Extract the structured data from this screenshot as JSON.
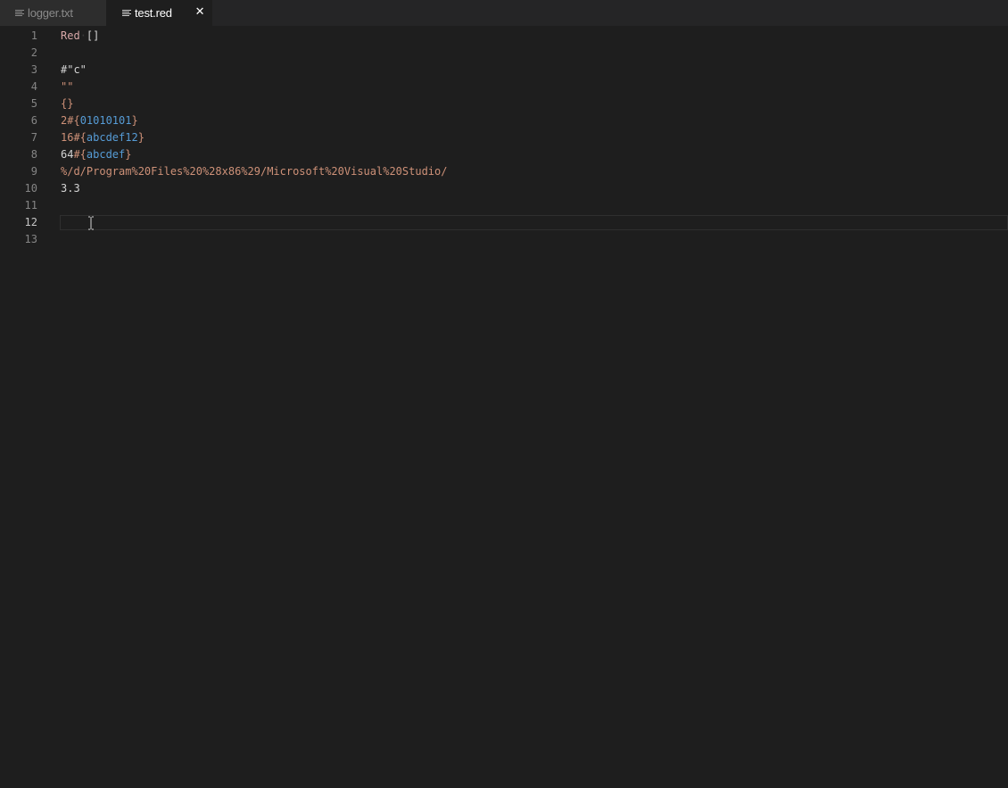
{
  "tabs": [
    {
      "label": "logger.txt",
      "icon": "file-lines-icon",
      "active": false
    },
    {
      "label": "test.red",
      "icon": "file-lines-icon",
      "active": true,
      "close": "✕"
    }
  ],
  "editor": {
    "current_line": 12,
    "lines": [
      {
        "n": "1",
        "text": "Red·[]"
      },
      {
        "n": "2",
        "text": ""
      },
      {
        "n": "3",
        "text": "#\"c\""
      },
      {
        "n": "4",
        "text": "\"\""
      },
      {
        "n": "5",
        "text": "{}"
      },
      {
        "n": "6",
        "text": "2#{01010101}"
      },
      {
        "n": "7",
        "text": "16#{abcdef12}"
      },
      {
        "n": "8",
        "text": "64#{abcdef}"
      },
      {
        "n": "9",
        "text": "%/d/Program%20Files%20%28x86%29/Microsoft%20Visual%20Studio/"
      },
      {
        "n": "10",
        "text": "3.3"
      },
      {
        "n": "11",
        "text": ""
      },
      {
        "n": "12",
        "text": ""
      },
      {
        "n": "13",
        "text": ""
      }
    ],
    "colors": {
      "background": "#1e1e1e",
      "line_number": "#858585",
      "word": "#d7a8a8",
      "string": "#ce9178",
      "hex": "#569cd6",
      "number": "#b5cea8"
    }
  }
}
